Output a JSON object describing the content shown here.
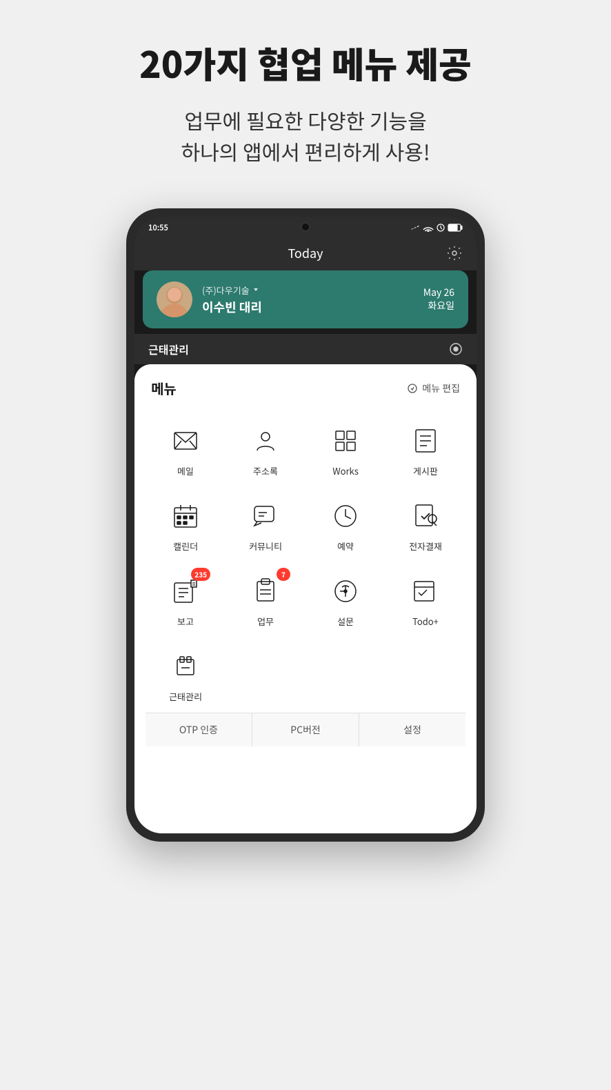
{
  "page": {
    "title": "20가지 협업 메뉴 제공",
    "subtitle_line1": "업무에 필요한 다양한 기능을",
    "subtitle_line2": "하나의 앱에서 편리하게 사용!"
  },
  "phone": {
    "status": {
      "time": "10:55",
      "icons": "▣ ▲"
    },
    "header": {
      "title": "Today"
    },
    "profile": {
      "company": "(주)다우기술",
      "name": "이수빈 대리",
      "date_line1": "May 26",
      "date_line2": "화요일"
    },
    "attendance": {
      "label": "근태관리",
      "arrow": "›"
    },
    "menu": {
      "title": "메뉴",
      "edit_label": "메뉴 편집",
      "items": [
        {
          "id": "mail",
          "label": "메일",
          "badge": null
        },
        {
          "id": "contacts",
          "label": "주소록",
          "badge": null
        },
        {
          "id": "works",
          "label": "Works",
          "badge": null
        },
        {
          "id": "board",
          "label": "게시판",
          "badge": null
        },
        {
          "id": "calendar",
          "label": "캘린더",
          "badge": null
        },
        {
          "id": "community",
          "label": "커뮤니티",
          "badge": null
        },
        {
          "id": "reservation",
          "label": "예약",
          "badge": null
        },
        {
          "id": "approval",
          "label": "전자결재",
          "badge": null
        },
        {
          "id": "report",
          "label": "보고",
          "badge": "235"
        },
        {
          "id": "task",
          "label": "업무",
          "badge": "7"
        },
        {
          "id": "survey",
          "label": "설문",
          "badge": null
        },
        {
          "id": "todo",
          "label": "Todo+",
          "badge": null
        },
        {
          "id": "attendance",
          "label": "근태관리",
          "badge": null
        }
      ]
    },
    "tabs": [
      {
        "label": "OTP 인증"
      },
      {
        "label": "PC버전"
      },
      {
        "label": "설정"
      }
    ]
  }
}
